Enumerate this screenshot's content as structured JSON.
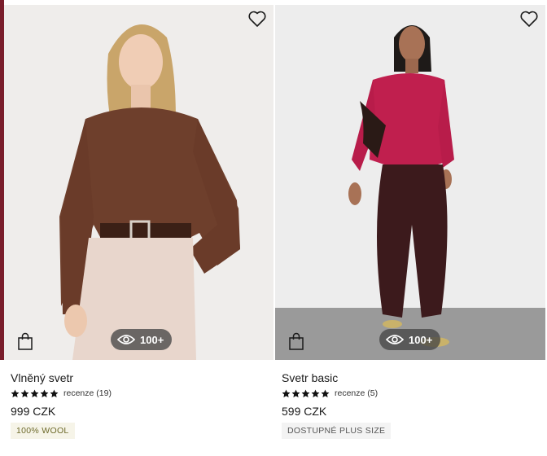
{
  "products": [
    {
      "name": "Vlněný svetr",
      "rating_stars": 5,
      "reviews": "recenze (19)",
      "price": "999 CZK",
      "badge": "100% WOOL",
      "views": "100+",
      "icons": {
        "favorite": "heart-outline-icon",
        "bag": "shopping-bag-icon",
        "views": "eye-icon"
      }
    },
    {
      "name": "Svetr basic",
      "rating_stars": 5,
      "reviews": "recenze (5)",
      "price": "599 CZK",
      "badge": "DOSTUPNÉ PLUS SIZE",
      "views": "100+",
      "icons": {
        "favorite": "heart-outline-icon",
        "bag": "shopping-bag-icon",
        "views": "eye-icon"
      }
    }
  ],
  "colors": {
    "accent_edge": "#7a1e2c",
    "badge_wool_bg": "#f6f4e8",
    "badge_wool_text": "#6d6a2a",
    "badge_plus_bg": "#f3f3f3",
    "badge_plus_text": "#555555"
  }
}
